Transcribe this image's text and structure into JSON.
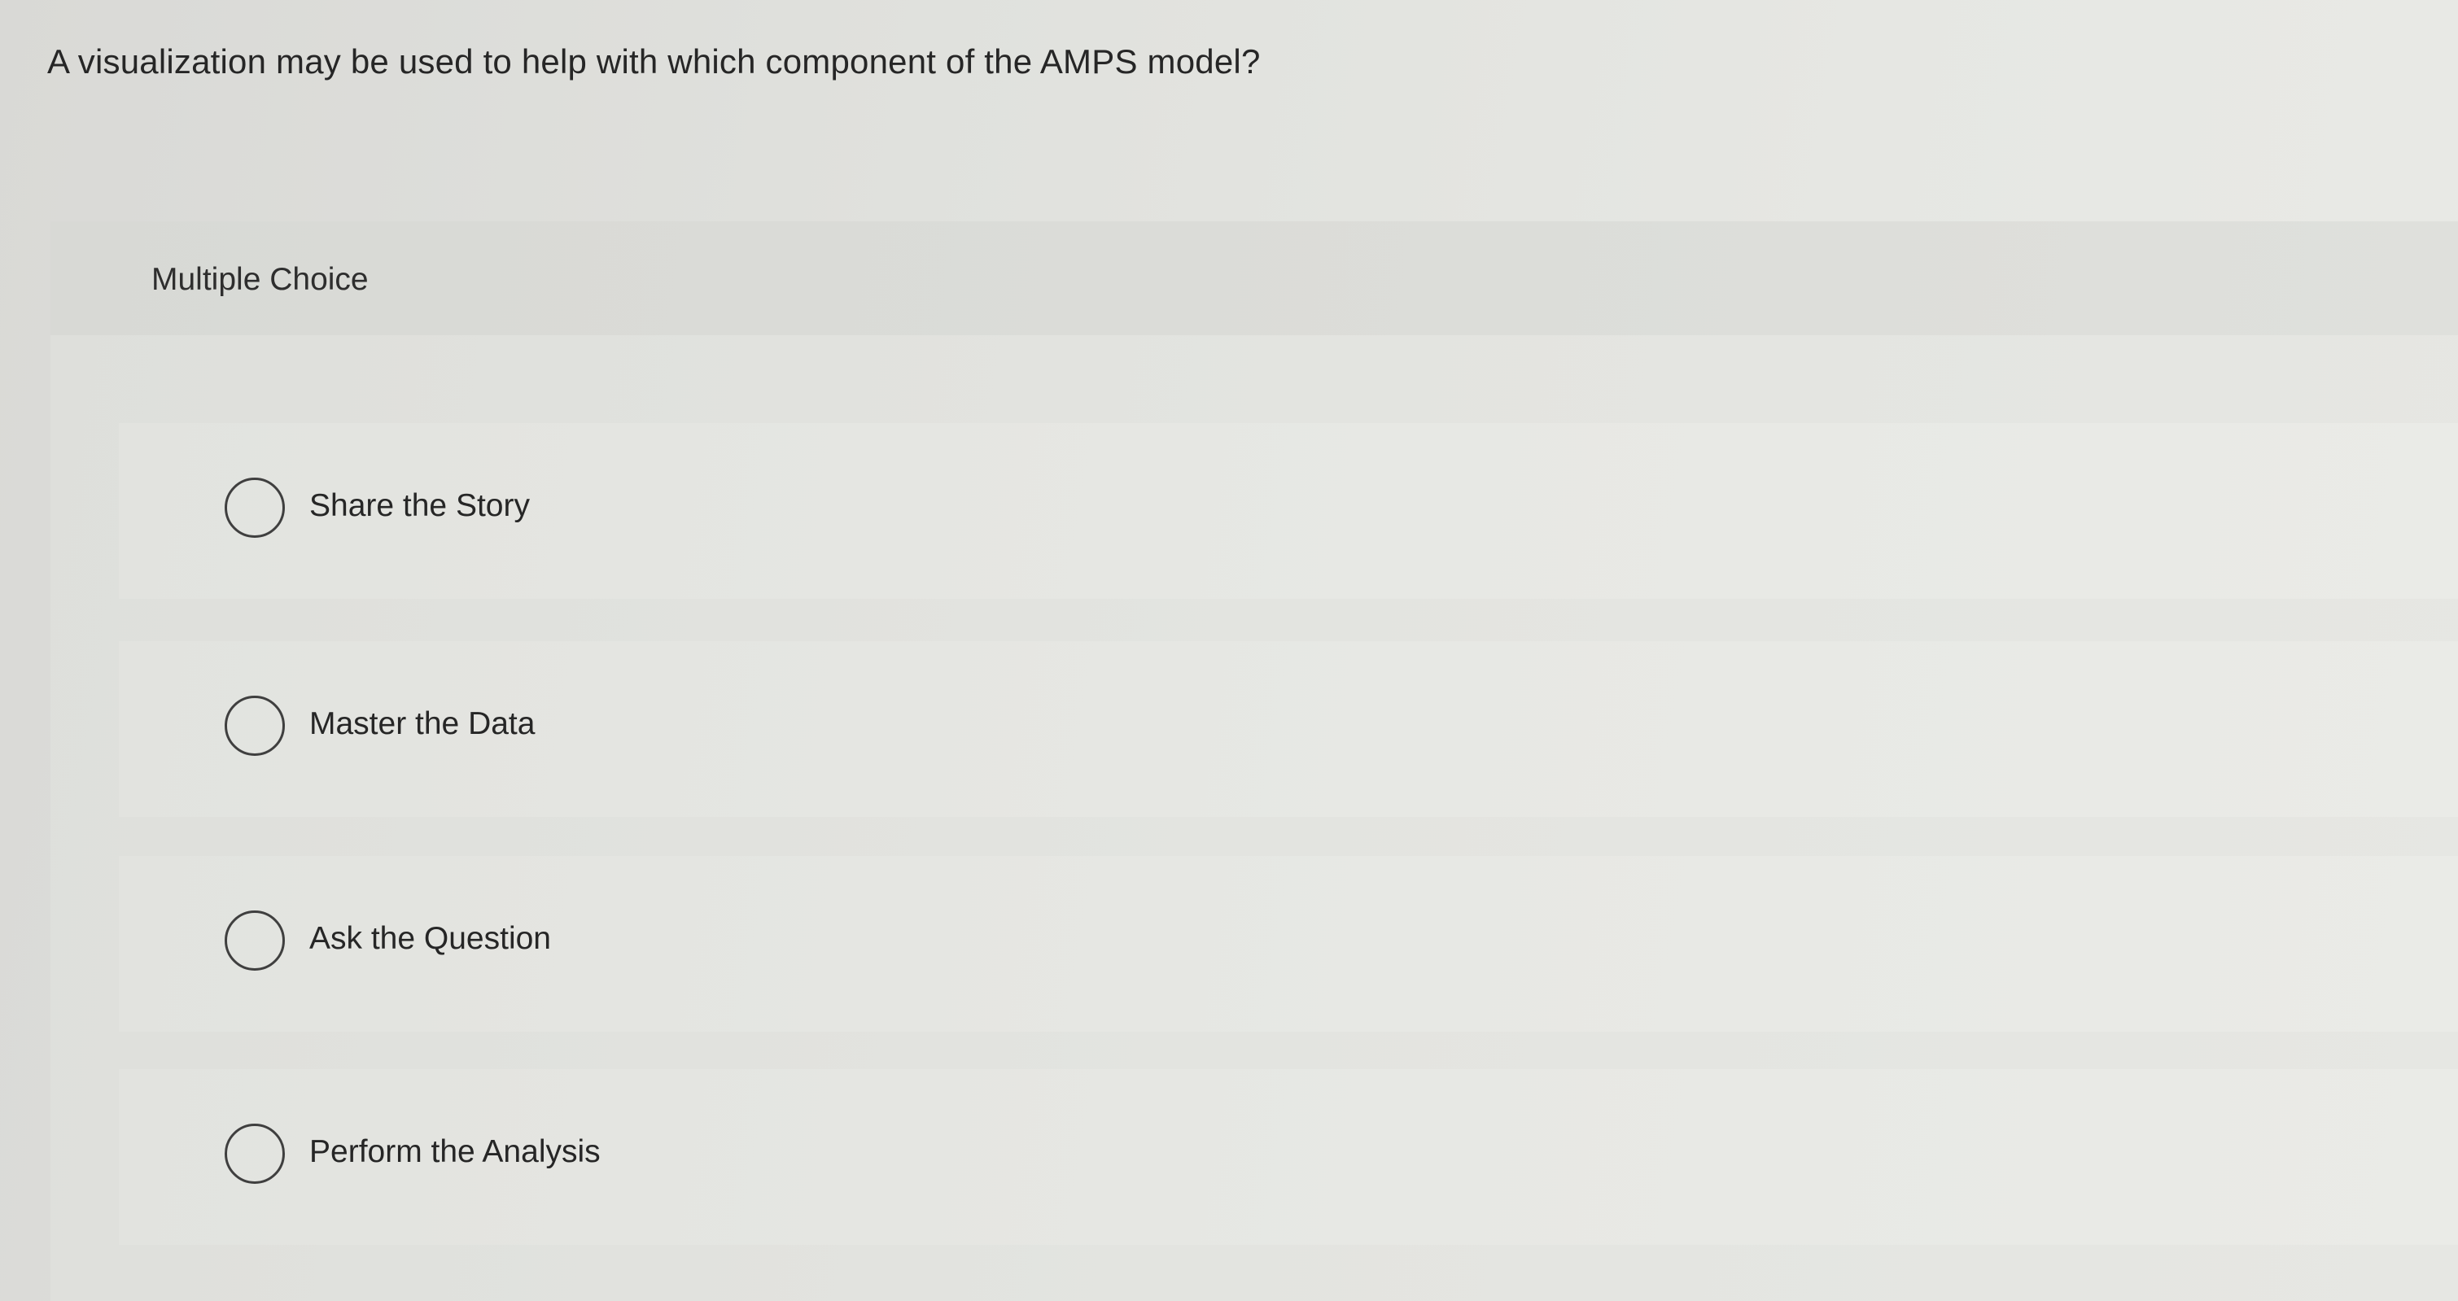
{
  "question": {
    "text": "A visualization may be used to help with which component of the AMPS model?"
  },
  "multiple_choice": {
    "label": "Multiple Choice",
    "options": [
      {
        "label": "Share the Story",
        "selected": false
      },
      {
        "label": "Master the Data",
        "selected": false
      },
      {
        "label": "Ask the Question",
        "selected": false
      },
      {
        "label": "Perform the Analysis",
        "selected": false
      }
    ]
  }
}
